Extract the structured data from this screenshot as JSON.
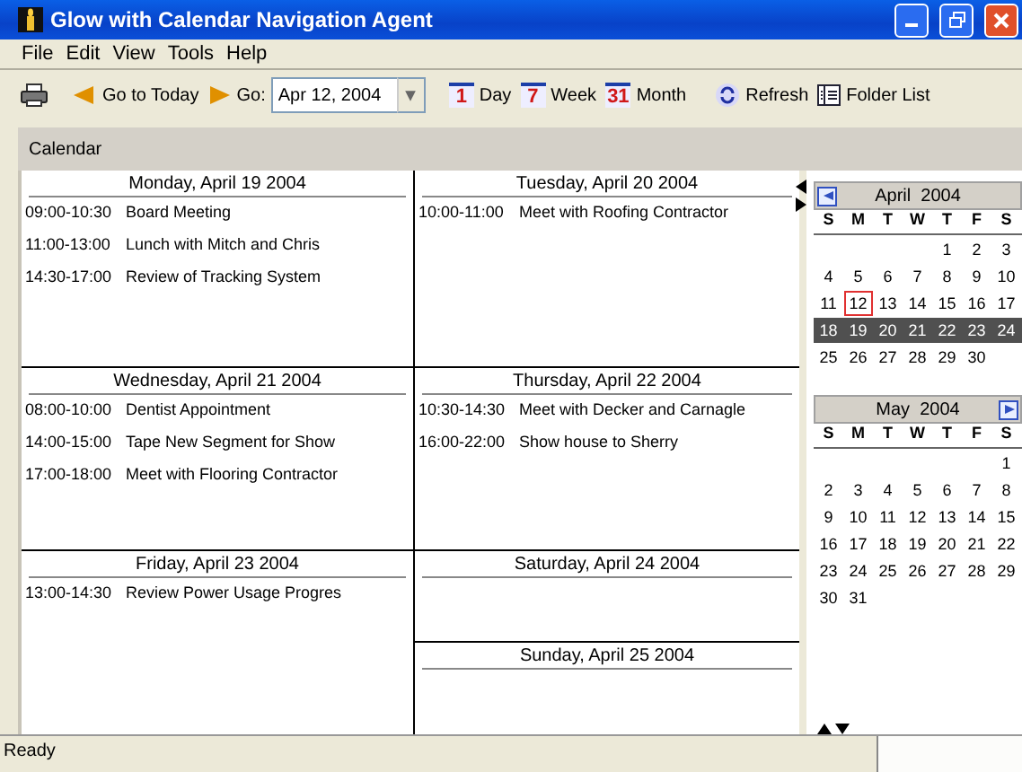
{
  "window": {
    "title": "Glow with Calendar Navigation Agent"
  },
  "menu": [
    "File",
    "Edit",
    "View",
    "Tools",
    "Help"
  ],
  "toolbar": {
    "today_label": "Go to Today",
    "go_label": "Go:",
    "date_value": "Apr 12, 2004",
    "views": [
      {
        "icon_text": "1",
        "label": "Day"
      },
      {
        "icon_text": "7",
        "label": "Week"
      },
      {
        "icon_text": "31",
        "label": "Month"
      }
    ],
    "refresh_label": "Refresh",
    "folder_label": "Folder List"
  },
  "pane_title": "Calendar",
  "week": [
    {
      "title": "Monday, April 19 2004",
      "events": [
        {
          "time": "09:00-10:30",
          "title": "Board Meeting"
        },
        {
          "time": "11:00-13:00",
          "title": "Lunch with Mitch and Chris"
        },
        {
          "time": "14:30-17:00",
          "title": "Review of Tracking System"
        }
      ]
    },
    {
      "title": "Tuesday, April 20 2004",
      "events": [
        {
          "time": "10:00-11:00",
          "title": "Meet with Roofing Contractor"
        }
      ]
    },
    {
      "title": "Wednesday, April 21 2004",
      "events": [
        {
          "time": "08:00-10:00",
          "title": "Dentist Appointment"
        },
        {
          "time": "14:00-15:00",
          "title": "Tape New Segment for Show"
        },
        {
          "time": "17:00-18:00",
          "title": "Meet with Flooring Contractor"
        }
      ]
    },
    {
      "title": "Thursday, April 22 2004",
      "events": [
        {
          "time": "10:30-14:30",
          "title": "Meet with Decker and Carnagle"
        },
        {
          "time": "16:00-22:00",
          "title": "Show house to Sherry"
        }
      ]
    },
    {
      "title": "Friday, April 23 2004",
      "events": [
        {
          "time": "13:00-14:30",
          "title": "Review Power Usage Progres"
        }
      ]
    },
    {
      "title": "Saturday, April 24 2004"
    },
    {
      "title": "Sunday, April 25 2004"
    }
  ],
  "mini_calendars": [
    {
      "title": "April  2004",
      "prev_button": true,
      "next_button": false,
      "weekdays": [
        "S",
        "M",
        "T",
        "W",
        "T",
        "F",
        "S"
      ],
      "weeks": [
        {
          "selected": false,
          "days": [
            {
              "kind": "blank"
            },
            {
              "kind": "blank"
            },
            {
              "kind": "blank"
            },
            {
              "kind": "blank"
            },
            {
              "kind": "day",
              "n": "1",
              "today": false
            },
            {
              "kind": "day",
              "n": "2",
              "today": false
            },
            {
              "kind": "day",
              "n": "3",
              "today": false
            }
          ]
        },
        {
          "selected": false,
          "days": [
            {
              "kind": "day",
              "n": "4",
              "today": false
            },
            {
              "kind": "day",
              "n": "5",
              "today": false
            },
            {
              "kind": "day",
              "n": "6",
              "today": false
            },
            {
              "kind": "day",
              "n": "7",
              "today": false
            },
            {
              "kind": "day",
              "n": "8",
              "today": false
            },
            {
              "kind": "day",
              "n": "9",
              "today": false
            },
            {
              "kind": "day",
              "n": "10",
              "today": false
            }
          ]
        },
        {
          "selected": false,
          "days": [
            {
              "kind": "day",
              "n": "11",
              "today": false
            },
            {
              "kind": "day",
              "n": "12",
              "today": true
            },
            {
              "kind": "day",
              "n": "13",
              "today": false
            },
            {
              "kind": "day",
              "n": "14",
              "today": false
            },
            {
              "kind": "day",
              "n": "15",
              "today": false
            },
            {
              "kind": "day",
              "n": "16",
              "today": false
            },
            {
              "kind": "day",
              "n": "17",
              "today": false
            }
          ]
        },
        {
          "selected": true,
          "days": [
            {
              "kind": "day",
              "n": "18",
              "today": false
            },
            {
              "kind": "day",
              "n": "19",
              "today": false
            },
            {
              "kind": "day",
              "n": "20",
              "today": false
            },
            {
              "kind": "day",
              "n": "21",
              "today": false
            },
            {
              "kind": "day",
              "n": "22",
              "today": false
            },
            {
              "kind": "day",
              "n": "23",
              "today": false
            },
            {
              "kind": "day",
              "n": "24",
              "today": false
            }
          ]
        },
        {
          "selected": false,
          "days": [
            {
              "kind": "day",
              "n": "25",
              "today": false
            },
            {
              "kind": "day",
              "n": "26",
              "today": false
            },
            {
              "kind": "day",
              "n": "27",
              "today": false
            },
            {
              "kind": "day",
              "n": "28",
              "today": false
            },
            {
              "kind": "day",
              "n": "29",
              "today": false
            },
            {
              "kind": "day",
              "n": "30",
              "today": false
            },
            {
              "kind": "blank"
            }
          ]
        }
      ]
    },
    {
      "title": "May  2004",
      "prev_button": false,
      "next_button": true,
      "weekdays": [
        "S",
        "M",
        "T",
        "W",
        "T",
        "F",
        "S"
      ],
      "weeks": [
        {
          "selected": false,
          "days": [
            {
              "kind": "blank"
            },
            {
              "kind": "blank"
            },
            {
              "kind": "blank"
            },
            {
              "kind": "blank"
            },
            {
              "kind": "blank"
            },
            {
              "kind": "blank"
            },
            {
              "kind": "day",
              "n": "1",
              "today": false
            }
          ]
        },
        {
          "selected": false,
          "days": [
            {
              "kind": "day",
              "n": "2",
              "today": false
            },
            {
              "kind": "day",
              "n": "3",
              "today": false
            },
            {
              "kind": "day",
              "n": "4",
              "today": false
            },
            {
              "kind": "day",
              "n": "5",
              "today": false
            },
            {
              "kind": "day",
              "n": "6",
              "today": false
            },
            {
              "kind": "day",
              "n": "7",
              "today": false
            },
            {
              "kind": "day",
              "n": "8",
              "today": false
            }
          ]
        },
        {
          "selected": false,
          "days": [
            {
              "kind": "day",
              "n": "9",
              "today": false
            },
            {
              "kind": "day",
              "n": "10",
              "today": false
            },
            {
              "kind": "day",
              "n": "11",
              "today": false
            },
            {
              "kind": "day",
              "n": "12",
              "today": false
            },
            {
              "kind": "day",
              "n": "13",
              "today": false
            },
            {
              "kind": "day",
              "n": "14",
              "today": false
            },
            {
              "kind": "day",
              "n": "15",
              "today": false
            }
          ]
        },
        {
          "selected": false,
          "days": [
            {
              "kind": "day",
              "n": "16",
              "today": false
            },
            {
              "kind": "day",
              "n": "17",
              "today": false
            },
            {
              "kind": "day",
              "n": "18",
              "today": false
            },
            {
              "kind": "day",
              "n": "19",
              "today": false
            },
            {
              "kind": "day",
              "n": "20",
              "today": false
            },
            {
              "kind": "day",
              "n": "21",
              "today": false
            },
            {
              "kind": "day",
              "n": "22",
              "today": false
            }
          ]
        },
        {
          "selected": false,
          "days": [
            {
              "kind": "day",
              "n": "23",
              "today": false
            },
            {
              "kind": "day",
              "n": "24",
              "today": false
            },
            {
              "kind": "day",
              "n": "25",
              "today": false
            },
            {
              "kind": "day",
              "n": "26",
              "today": false
            },
            {
              "kind": "day",
              "n": "27",
              "today": false
            },
            {
              "kind": "day",
              "n": "28",
              "today": false
            },
            {
              "kind": "day",
              "n": "29",
              "today": false
            }
          ]
        },
        {
          "selected": false,
          "days": [
            {
              "kind": "day",
              "n": "30",
              "today": false
            },
            {
              "kind": "day",
              "n": "31",
              "today": false
            },
            {
              "kind": "blank"
            },
            {
              "kind": "blank"
            },
            {
              "kind": "blank"
            },
            {
              "kind": "blank"
            },
            {
              "kind": "blank"
            }
          ]
        }
      ]
    }
  ],
  "status_bar": {
    "text": "Ready"
  }
}
